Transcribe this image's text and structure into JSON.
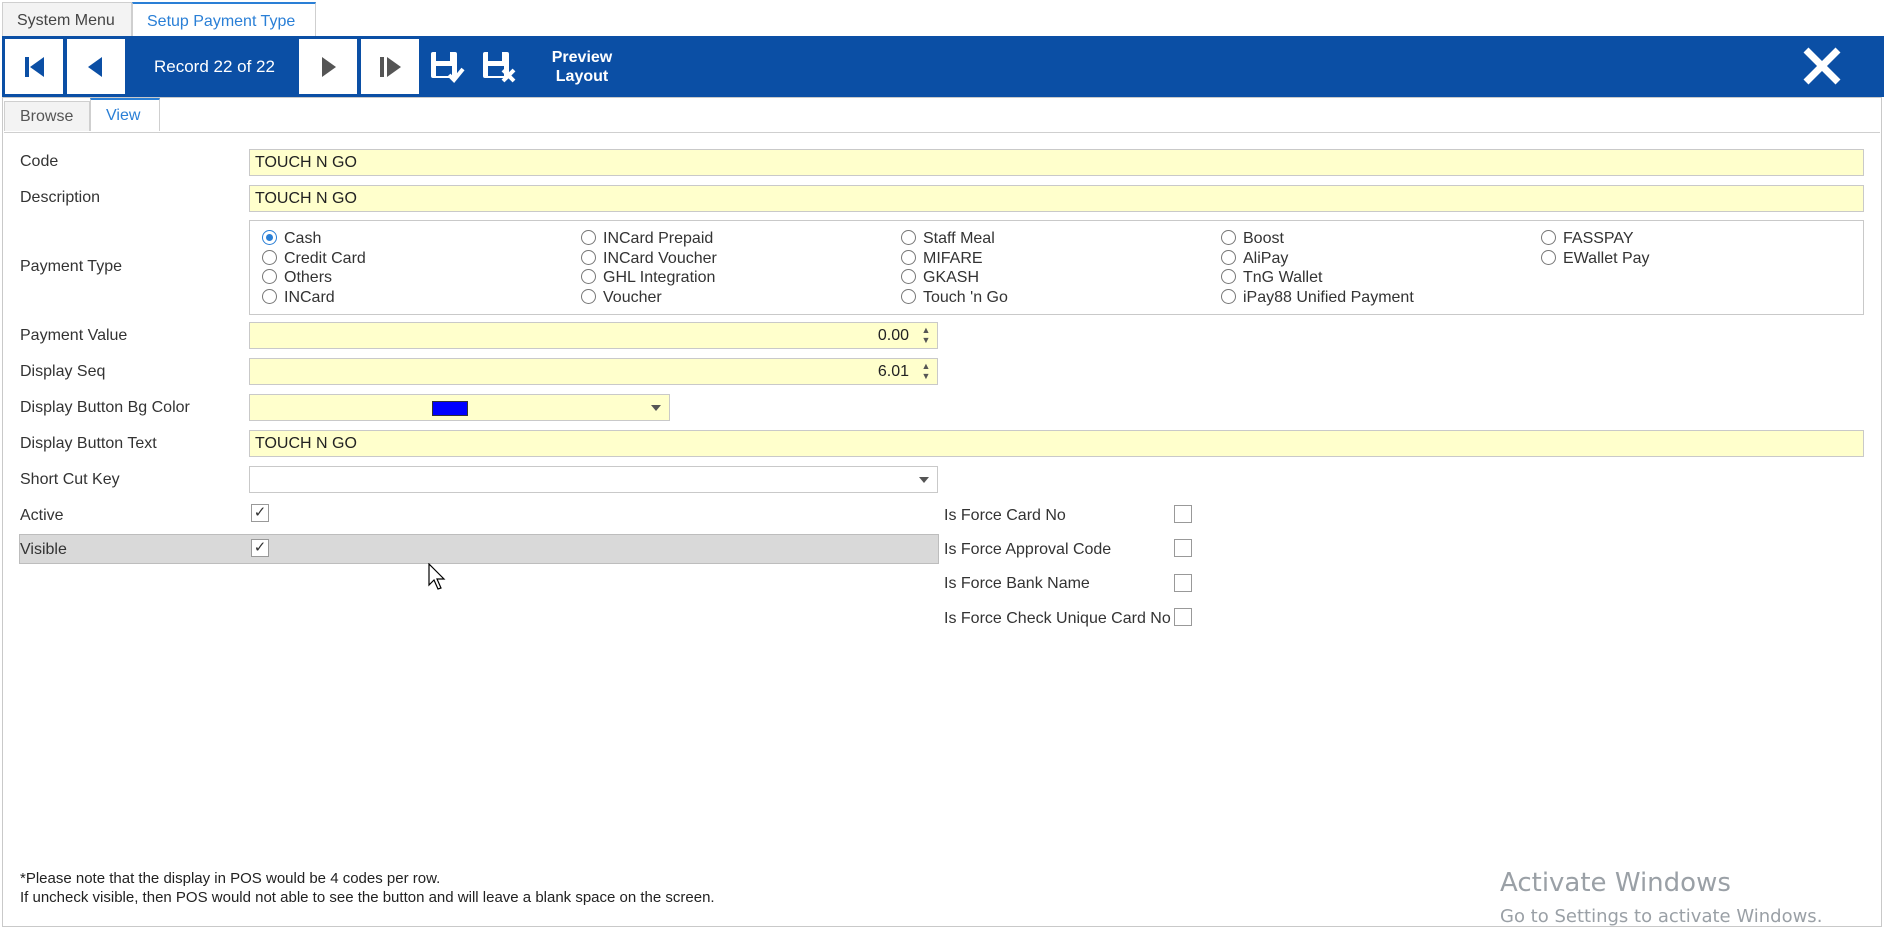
{
  "top_tabs": [
    {
      "label": "System Menu",
      "active": false
    },
    {
      "label": "Setup Payment Type",
      "active": true
    }
  ],
  "toolbar": {
    "record_text": "Record 22 of 22",
    "preview_label_line1": "Preview",
    "preview_label_line2": "Layout",
    "icons": [
      "first-record-icon",
      "previous-record-icon",
      "next-record-icon",
      "last-record-icon",
      "save-icon",
      "cancel-save-icon",
      "close-icon"
    ],
    "bg_color": "#0b4fa5"
  },
  "sub_tabs": [
    {
      "label": "Browse",
      "active": false
    },
    {
      "label": "View",
      "active": true
    }
  ],
  "form": {
    "code": {
      "label": "Code",
      "value": "TOUCH N GO"
    },
    "description": {
      "label": "Description",
      "value": "TOUCH N GO"
    },
    "payment_type": {
      "label": "Payment Type",
      "selected": "Cash",
      "options": [
        [
          "Cash",
          "Credit Card",
          "Others",
          "INCard"
        ],
        [
          "INCard Prepaid",
          "INCard Voucher",
          "GHL Integration",
          "Voucher"
        ],
        [
          "Staff Meal",
          "MIFARE",
          "GKASH",
          "Touch 'n Go"
        ],
        [
          "Boost",
          "AliPay",
          "TnG Wallet",
          "iPay88 Unified Payment"
        ],
        [
          "FASSPAY",
          "EWallet Pay"
        ]
      ]
    },
    "payment_value": {
      "label": "Payment Value",
      "value": "0.00"
    },
    "display_seq": {
      "label": "Display Seq",
      "value": "6.01"
    },
    "display_button_bg_color": {
      "label": "Display Button Bg Color",
      "color": "#0000ff"
    },
    "display_button_text": {
      "label": "Display Button Text",
      "value": "TOUCH N GO"
    },
    "short_cut_key": {
      "label": "Short Cut Key",
      "value": ""
    },
    "active": {
      "label": "Active",
      "checked": true,
      "mark": "✓"
    },
    "visible": {
      "label": "Visible",
      "checked": true,
      "mark": "✓"
    },
    "is_force_card_no": {
      "label": "Is Force Card No",
      "checked": false
    },
    "is_force_approval_code": {
      "label": "Is Force Approval Code",
      "checked": false
    },
    "is_force_bank_name": {
      "label": "Is Force Bank Name",
      "checked": false
    },
    "is_force_check_unique_card_no": {
      "label": "Is Force Check Unique Card No",
      "checked": false
    }
  },
  "notes": {
    "line1": "*Please note that the display in POS would be 4 codes per row.",
    "line2": "If uncheck visible, then POS would not able to see the button and will leave a blank space on the screen."
  },
  "watermark": {
    "line1": "Activate Windows",
    "line2": "Go to Settings to activate Windows."
  }
}
